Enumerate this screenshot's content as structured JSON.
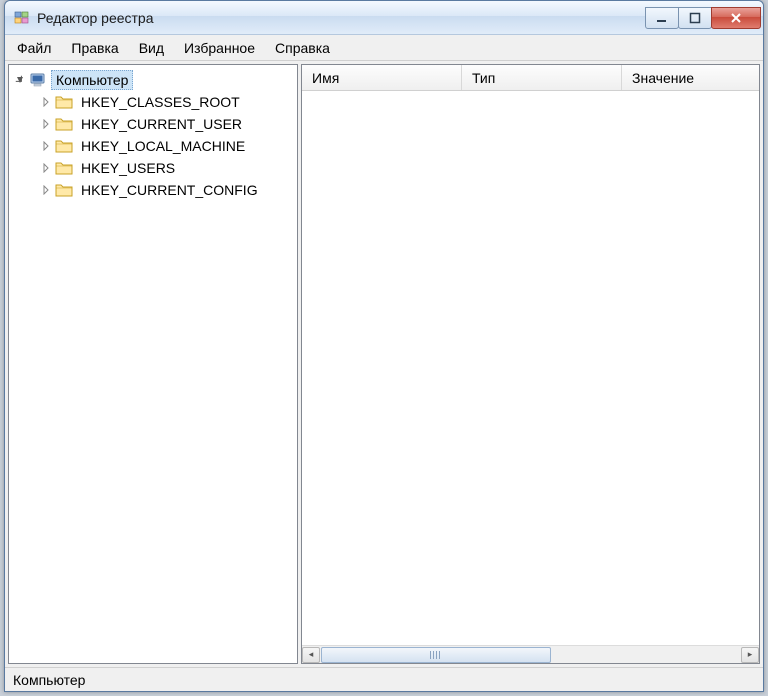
{
  "window": {
    "title": "Редактор реестра"
  },
  "menu": {
    "file": "Файл",
    "edit": "Правка",
    "view": "Вид",
    "favorites": "Избранное",
    "help": "Справка"
  },
  "tree": {
    "root_label": "Компьютер",
    "hives": [
      "HKEY_CLASSES_ROOT",
      "HKEY_CURRENT_USER",
      "HKEY_LOCAL_MACHINE",
      "HKEY_USERS",
      "HKEY_CURRENT_CONFIG"
    ]
  },
  "columns": {
    "name": "Имя",
    "type": "Тип",
    "value": "Значение"
  },
  "statusbar": {
    "path": "Компьютер"
  }
}
